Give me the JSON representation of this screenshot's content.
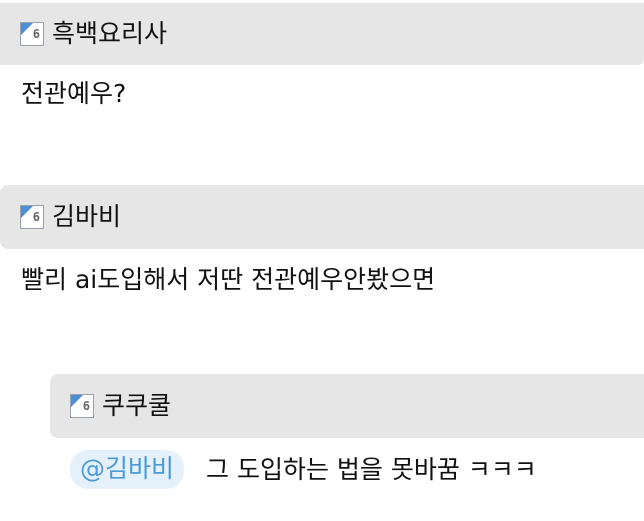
{
  "posts": [
    {
      "author": "흑백요리사",
      "badge_number": "6",
      "text": "전관예우?"
    },
    {
      "author": "김바비",
      "badge_number": "6",
      "text": "빨리 ai도입해서 저딴 전관예우안봤으면"
    }
  ],
  "reply": {
    "author": "쿠쿠쿨",
    "badge_number": "6",
    "mention": "@김바비",
    "text": "그 도입하는 법을 못바꿈 ㅋㅋㅋ"
  },
  "colors": {
    "header_bg": "#e6e6e6",
    "mention_bg": "#e4f1fb",
    "mention_text": "#4a9ad6",
    "badge_accent": "#4d8fd6"
  }
}
